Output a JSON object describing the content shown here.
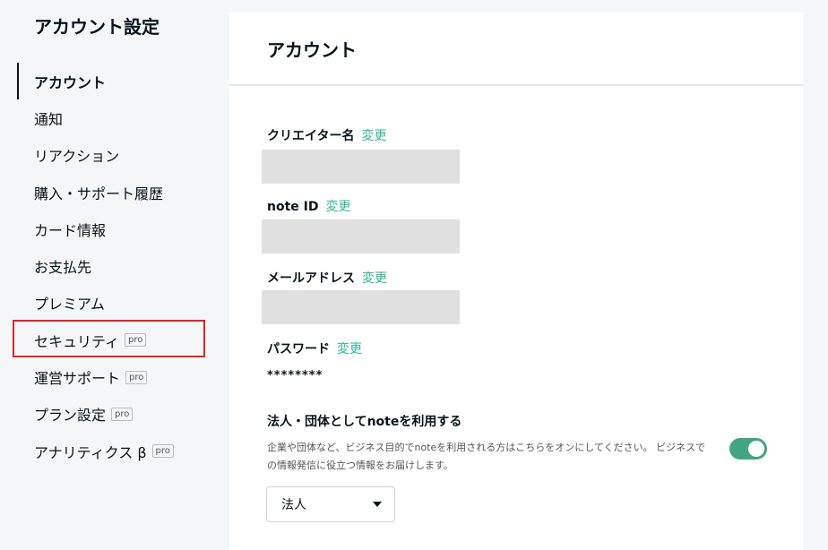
{
  "sidebar": {
    "title": "アカウント設定",
    "items": [
      {
        "label": "アカウント",
        "active": true
      },
      {
        "label": "通知"
      },
      {
        "label": "リアクション"
      },
      {
        "label": "購入・サポート履歴"
      },
      {
        "label": "カード情報"
      },
      {
        "label": "お支払先"
      },
      {
        "label": "プレミアム"
      },
      {
        "label": "セキュリティ",
        "badge": "pro"
      },
      {
        "label": "運営サポート",
        "badge": "pro"
      },
      {
        "label": "プラン設定",
        "badge": "pro"
      },
      {
        "label": "アナリティクス β",
        "badge": "pro"
      }
    ]
  },
  "main": {
    "title": "アカウント",
    "creator_name": {
      "label": "クリエイター名",
      "change": "変更"
    },
    "note_id": {
      "label": "note ID",
      "change": "変更"
    },
    "email": {
      "label": "メールアドレス",
      "change": "変更"
    },
    "password": {
      "label": "パスワード",
      "change": "変更",
      "value": "********"
    },
    "corporate": {
      "title": "法人・団体としてnoteを利用する",
      "description": "企業や団体など、ビジネス目的でnoteを利用される方はこちらをオンにしてください。 ビジネスでの情報発信に役立つ情報をお届けします。",
      "toggle_on": true,
      "select_value": "法人"
    }
  },
  "colors": {
    "accent": "#2cb696",
    "toggle": "#41a583",
    "highlight": "#e02424"
  }
}
